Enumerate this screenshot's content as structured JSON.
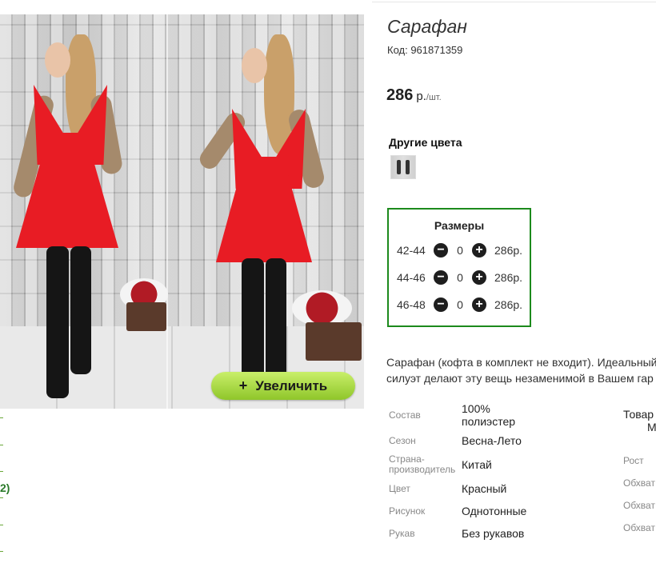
{
  "product": {
    "title": "Сарафан",
    "code": "Код: 961871359",
    "price_value": "286",
    "price_currency": "р.",
    "price_unit": "/шт."
  },
  "photo": {
    "zoom_button_icon": "plus-icon",
    "zoom_button_icon_glyph": "+",
    "zoom_button_label": "Увеличить"
  },
  "left_partial": {
    "text": "2)"
  },
  "other_colors": {
    "title": "Другие цвета"
  },
  "sizes": {
    "title": "Размеры",
    "rows": [
      {
        "size": "42-44",
        "qty": "0",
        "price": "286р."
      },
      {
        "size": "44-46",
        "qty": "0",
        "price": "286р."
      },
      {
        "size": "46-48",
        "qty": "0",
        "price": "286р."
      }
    ],
    "minus_glyph": "−",
    "plus_glyph": "+"
  },
  "description": {
    "line1": "Сарафан (кофта в комплект не входит). Идеальный",
    "line2": "силуэт делают эту вещь незаменимой в Вашем гар"
  },
  "attributes": [
    {
      "label": "Состав",
      "value1": "100%",
      "value2": "полиэстер"
    },
    {
      "label": "Сезон",
      "value": "Весна-Лето"
    },
    {
      "label1": "Страна-",
      "label2": "производитель",
      "value": "Китай"
    },
    {
      "label": "Цвет",
      "value": "Красный"
    },
    {
      "label": "Рисунок",
      "value": "Однотонные"
    },
    {
      "label": "Рукав",
      "value": "Без рукавов"
    }
  ],
  "attributes_right": {
    "model_line1": "Товар",
    "model_line2": "М",
    "height_label": "Рост",
    "girth_labels": [
      "Обхват",
      "Обхват",
      "Обхват"
    ]
  },
  "colors": {
    "accent_green": "#1c8a1c",
    "button_green_top": "#c9ef6a",
    "button_green_bottom": "#8fc62a",
    "dress_red": "#e81c24"
  }
}
